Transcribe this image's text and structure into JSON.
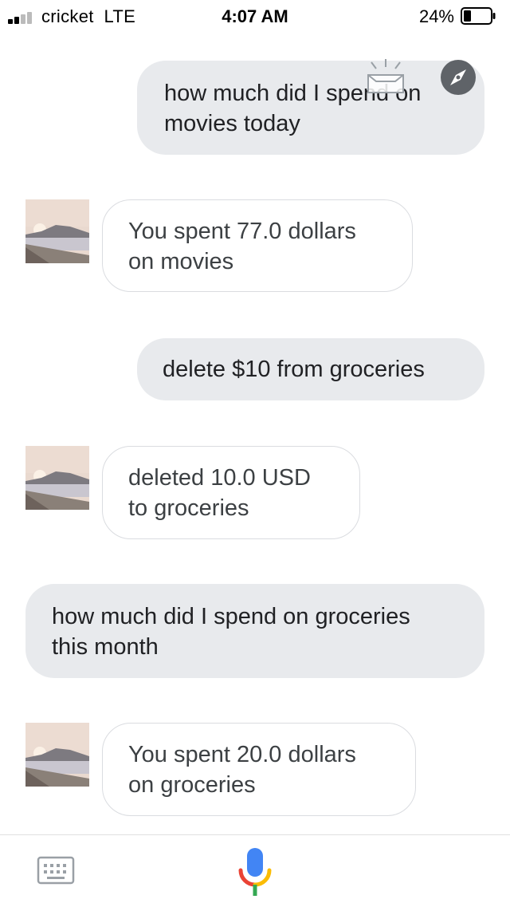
{
  "status_bar": {
    "carrier": "cricket",
    "network": "LTE",
    "time": "4:07 AM",
    "battery_percent": "24%"
  },
  "conversation": {
    "messages": [
      {
        "sender": "user",
        "text": "how much did I spend on\nmovies today"
      },
      {
        "sender": "assistant",
        "text": "You spent 77.0 dollars\non movies"
      },
      {
        "sender": "user",
        "text": "delete $10 from groceries"
      },
      {
        "sender": "assistant",
        "text": "deleted 10.0 USD\nto groceries"
      },
      {
        "sender": "user",
        "text": "how much did I spend on groceries\nthis month"
      },
      {
        "sender": "assistant",
        "text": "You spent 20.0 dollars\non groceries"
      }
    ]
  },
  "icons": {
    "keyboard": "keyboard-icon",
    "mic": "microphone-icon",
    "safari": "compass-icon"
  },
  "colors": {
    "user_bubble": "#e8eaed",
    "bot_border": "#dadce0",
    "mic_blue": "#4285f4",
    "mic_red": "#ea4335",
    "mic_yellow": "#fbbc05",
    "mic_green": "#34a853"
  }
}
